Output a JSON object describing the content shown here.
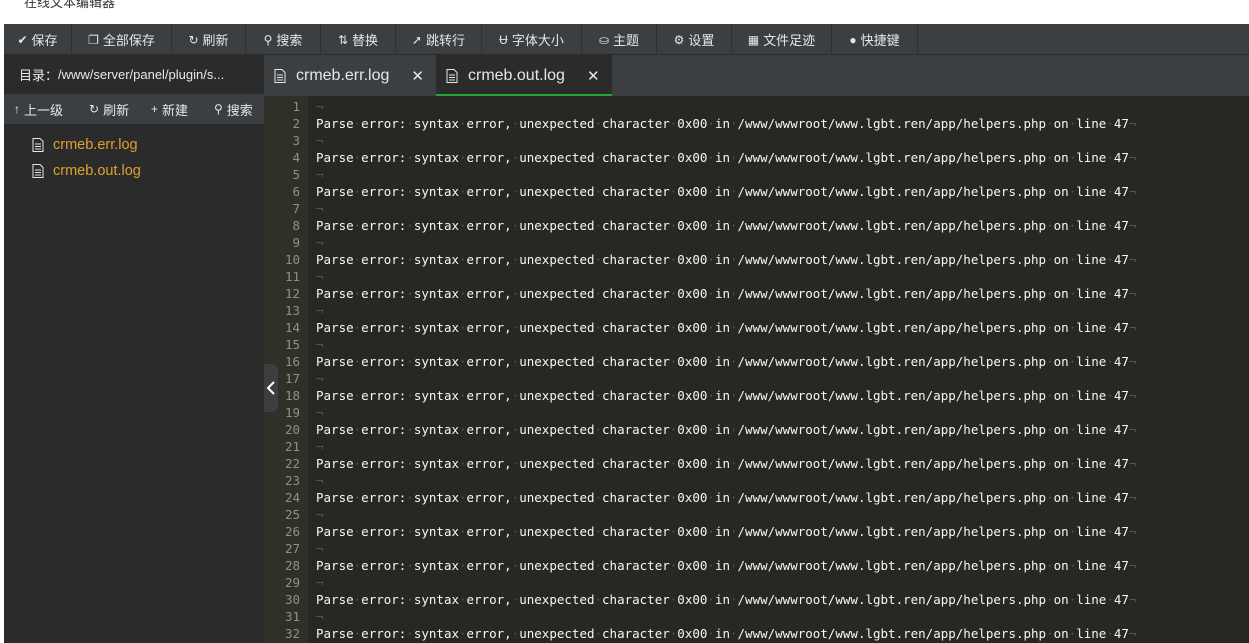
{
  "window": {
    "title": "在线文本编辑器"
  },
  "toolbar": [
    {
      "name": "save-button",
      "icon_name": "save-icon",
      "glyph": "✔",
      "label": "保存",
      "w": 68
    },
    {
      "name": "save-all-button",
      "icon_name": "save-all-icon",
      "glyph": "❐",
      "label": "全部保存",
      "w": 100
    },
    {
      "name": "refresh-button",
      "icon_name": "refresh-icon",
      "glyph": "↻",
      "label": "刷新",
      "w": 74
    },
    {
      "name": "search-button",
      "icon_name": "search-icon",
      "glyph": "⚲",
      "label": "搜索",
      "w": 75
    },
    {
      "name": "replace-button",
      "icon_name": "replace-icon",
      "glyph": "⇅",
      "label": "替换",
      "w": 75
    },
    {
      "name": "goto-line-button",
      "icon_name": "goto-icon",
      "glyph": "➚",
      "label": "跳转行",
      "w": 86
    },
    {
      "name": "font-size-button",
      "icon_name": "font-icon",
      "glyph": "Ʉ",
      "label": "字体大小",
      "w": 100
    },
    {
      "name": "theme-button",
      "icon_name": "theme-icon",
      "glyph": "⛀",
      "label": "主题",
      "w": 75
    },
    {
      "name": "settings-button",
      "icon_name": "gear-icon",
      "glyph": "⚙",
      "label": "设置",
      "w": 75
    },
    {
      "name": "file-history-button",
      "icon_name": "calendar-icon",
      "glyph": "▦",
      "label": "文件足迹",
      "w": 100
    },
    {
      "name": "shortcuts-button",
      "icon_name": "info-icon",
      "glyph": "●",
      "label": "快捷键",
      "w": 86
    }
  ],
  "sidebar": {
    "dir_label": "目录：",
    "dir_path": "/www/server/panel/plugin/s...",
    "actions": [
      {
        "name": "up-level-button",
        "icon_name": "arrow-up-icon",
        "glyph": "↑",
        "label": "上一级"
      },
      {
        "name": "refresh-dir-button",
        "icon_name": "refresh-icon",
        "glyph": "↻",
        "label": "刷新"
      },
      {
        "name": "new-file-button",
        "icon_name": "plus-icon",
        "glyph": "+",
        "label": "新建"
      },
      {
        "name": "search-dir-button",
        "icon_name": "search-icon",
        "glyph": "⚲",
        "label": "搜索"
      }
    ],
    "files": [
      {
        "name": "crmeb.err.log"
      },
      {
        "name": "crmeb.out.log"
      }
    ]
  },
  "tabs": [
    {
      "label": "crmeb.err.log",
      "active": false
    },
    {
      "label": "crmeb.out.log",
      "active": true
    }
  ],
  "editor": {
    "error_line": "Parse error: syntax error, unexpected character 0x00 in /www/wwwroot/www.lgbt.ren/app/helpers.php on line 47",
    "line_count": 32
  },
  "colors": {
    "accent_green": "#20a53a",
    "file_name": "#e0a030",
    "editor_bg": "#272822"
  }
}
